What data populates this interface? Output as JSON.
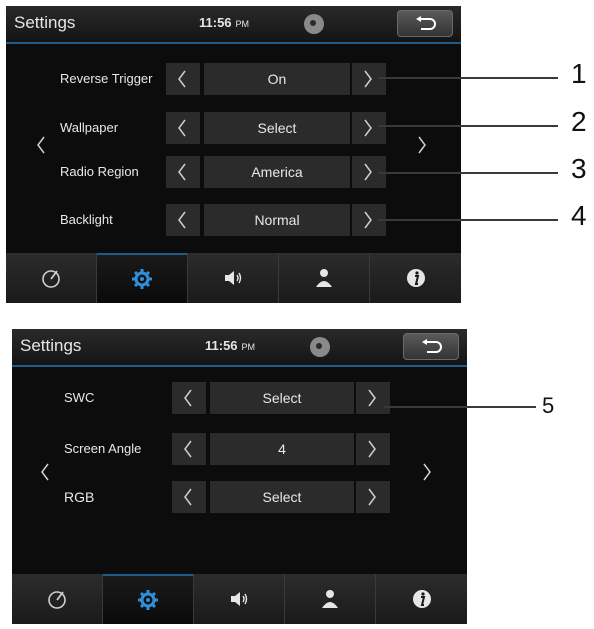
{
  "screens": [
    {
      "header": {
        "title": "Settings",
        "time": "11:56",
        "ampm": "PM"
      },
      "rows": [
        {
          "label": "Reverse Trigger",
          "value": "On"
        },
        {
          "label": "Wallpaper",
          "value": "Select"
        },
        {
          "label": "Radio Region",
          "value": "America"
        },
        {
          "label": "Backlight",
          "value": "Normal"
        }
      ]
    },
    {
      "header": {
        "title": "Settings",
        "time": "11:56",
        "ampm": "PM"
      },
      "rows": [
        {
          "label": "SWC",
          "value": "Select"
        },
        {
          "label": "Screen Angle",
          "value": "4"
        },
        {
          "label": "RGB",
          "value": "Select"
        }
      ]
    }
  ],
  "footer_tabs": [
    "gauge-icon",
    "gear-icon",
    "speaker-icon",
    "person-icon",
    "info-icon"
  ],
  "accent_color": "#1d5b8a",
  "callouts": [
    "1",
    "2",
    "3",
    "4",
    "5"
  ]
}
